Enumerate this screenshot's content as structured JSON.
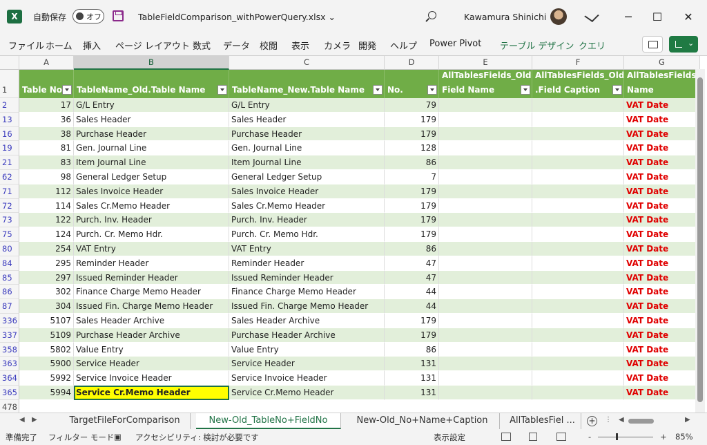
{
  "titlebar": {
    "app_icon": "X",
    "autosave_label": "自動保存",
    "toggle_label": "オフ",
    "filename": "TableFieldComparison_withPowerQuery.xlsx ⌄",
    "username": "Kawamura Shinichi"
  },
  "menu": [
    "ファイル",
    "ホーム",
    "挿入",
    "ページ レイアウト",
    "数式",
    "データ",
    "校閲",
    "表示",
    "カメラ",
    "開発",
    "ヘルプ",
    "Power Pivot",
    "テーブル デザイン",
    "クエリ"
  ],
  "columns": [
    "A",
    "B",
    "C",
    "D",
    "E",
    "F",
    "G"
  ],
  "header_row": {
    "row_number": "1",
    "cells": [
      {
        "l1": "",
        "l2": "Table No."
      },
      {
        "l1": "",
        "l2": "TableName_Old.Table Name"
      },
      {
        "l1": "",
        "l2": "TableName_New.Table Name"
      },
      {
        "l1": "",
        "l2": "No."
      },
      {
        "l1": "AllTablesFields_Old.",
        "l2": "Field Name"
      },
      {
        "l1": "AllTablesFields_Old",
        "l2": ".Field Caption"
      },
      {
        "l1": "AllTablesFields",
        "l2": "Name"
      }
    ]
  },
  "rows": [
    {
      "row": "2",
      "no": "17",
      "old": "G/L Entry",
      "new": "G/L Entry",
      "fno": "79",
      "g": "VAT Date"
    },
    {
      "row": "13",
      "no": "36",
      "old": "Sales Header",
      "new": "Sales Header",
      "fno": "179",
      "g": "VAT Date"
    },
    {
      "row": "16",
      "no": "38",
      "old": "Purchase Header",
      "new": "Purchase Header",
      "fno": "179",
      "g": "VAT Date"
    },
    {
      "row": "19",
      "no": "81",
      "old": "Gen. Journal Line",
      "new": "Gen. Journal Line",
      "fno": "128",
      "g": "VAT Date"
    },
    {
      "row": "21",
      "no": "83",
      "old": "Item Journal Line",
      "new": "Item Journal Line",
      "fno": "86",
      "g": "VAT Date"
    },
    {
      "row": "62",
      "no": "98",
      "old": "General Ledger Setup",
      "new": "General Ledger Setup",
      "fno": "7",
      "g": "VAT Date"
    },
    {
      "row": "71",
      "no": "112",
      "old": "Sales Invoice Header",
      "new": "Sales Invoice Header",
      "fno": "179",
      "g": "VAT Date"
    },
    {
      "row": "72",
      "no": "114",
      "old": "Sales Cr.Memo Header",
      "new": "Sales Cr.Memo Header",
      "fno": "179",
      "g": "VAT Date"
    },
    {
      "row": "73",
      "no": "122",
      "old": "Purch. Inv. Header",
      "new": "Purch. Inv. Header",
      "fno": "179",
      "g": "VAT Date"
    },
    {
      "row": "75",
      "no": "124",
      "old": "Purch. Cr. Memo Hdr.",
      "new": "Purch. Cr. Memo Hdr.",
      "fno": "179",
      "g": "VAT Date"
    },
    {
      "row": "80",
      "no": "254",
      "old": "VAT Entry",
      "new": "VAT Entry",
      "fno": "86",
      "g": "VAT Date"
    },
    {
      "row": "84",
      "no": "295",
      "old": "Reminder Header",
      "new": "Reminder Header",
      "fno": "47",
      "g": "VAT Date"
    },
    {
      "row": "85",
      "no": "297",
      "old": "Issued Reminder Header",
      "new": "Issued Reminder Header",
      "fno": "47",
      "g": "VAT Date"
    },
    {
      "row": "86",
      "no": "302",
      "old": "Finance Charge Memo Header",
      "new": "Finance Charge Memo Header",
      "fno": "44",
      "g": "VAT Date"
    },
    {
      "row": "87",
      "no": "304",
      "old": "Issued Fin. Charge Memo Header",
      "new": "Issued Fin. Charge Memo Header",
      "fno": "44",
      "g": "VAT Date"
    },
    {
      "row": "336",
      "no": "5107",
      "old": "Sales Header Archive",
      "new": "Sales Header Archive",
      "fno": "179",
      "g": "VAT Date"
    },
    {
      "row": "337",
      "no": "5109",
      "old": "Purchase Header Archive",
      "new": "Purchase Header Archive",
      "fno": "179",
      "g": "VAT Date"
    },
    {
      "row": "358",
      "no": "5802",
      "old": "Value Entry",
      "new": "Value Entry",
      "fno": "86",
      "g": "VAT Date"
    },
    {
      "row": "363",
      "no": "5900",
      "old": "Service Header",
      "new": "Service Header",
      "fno": "131",
      "g": "VAT Date"
    },
    {
      "row": "364",
      "no": "5992",
      "old": "Service Invoice Header",
      "new": "Service Invoice Header",
      "fno": "131",
      "g": "VAT Date"
    },
    {
      "row": "365",
      "no": "5994",
      "old": "Service Cr.Memo Header",
      "new": "Service Cr.Memo Header",
      "fno": "131",
      "g": "VAT Date",
      "highlight": true
    }
  ],
  "last_row": "478",
  "tabs": [
    {
      "label": "TargetFileForComparison",
      "active": false
    },
    {
      "label": "New-Old_TableNo+FieldNo",
      "active": true
    },
    {
      "label": "New-Old_No+Name+Caption",
      "active": false
    },
    {
      "label": "AllTablesFiel ...",
      "active": false
    }
  ],
  "status": {
    "ready": "準備完了",
    "filter_mode": "フィルター モード",
    "accessibility": "アクセシビリティ: 検討が必要です",
    "display_settings": "表示設定",
    "zoom": "85%",
    "zoom_minus": "-",
    "zoom_plus": "+"
  },
  "colors": {
    "table_header": "#70ad47",
    "band": "#e2efda",
    "vat_text": "#e00000",
    "highlight": "#ffff00",
    "accent": "#217346"
  },
  "icons": [
    "excel-logo-icon",
    "save-icon",
    "search-icon",
    "avatar",
    "pen-icon",
    "minimize-icon",
    "maximize-icon",
    "close-icon",
    "comment-icon",
    "share-icon",
    "filter-dropdown-icon",
    "add-sheet-icon"
  ]
}
